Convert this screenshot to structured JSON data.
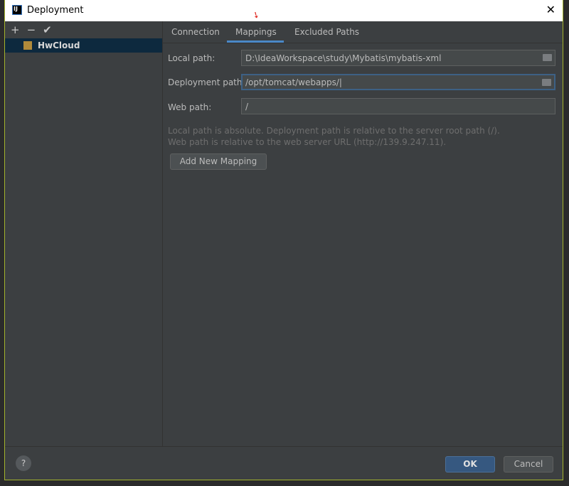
{
  "window": {
    "title": "Deployment"
  },
  "sidebar": {
    "toolbar": [
      "+",
      "−",
      "✔"
    ],
    "items": [
      {
        "label": "HwCloud",
        "selected": true,
        "icon": "sftp-server-icon"
      }
    ]
  },
  "tabs": [
    {
      "label": "Connection"
    },
    {
      "label": "Mappings",
      "active": true
    },
    {
      "label": "Excluded Paths"
    }
  ],
  "form": {
    "local_path": {
      "label": "Local path:",
      "value": "D:\\IdeaWorkspace\\study\\Mybatis\\mybatis-xml"
    },
    "deployment_path": {
      "label": "Deployment path:",
      "value": "/opt/tomcat/webapps/"
    },
    "web_path": {
      "label": "Web path:",
      "value": "/"
    },
    "hint1": "Local path is absolute. Deployment path is relative to the server root path (/).",
    "hint2": "Web path is relative to the web server URL (http://139.9.247.11).",
    "add_button": "Add New Mapping"
  },
  "footer": {
    "help": "?",
    "ok": "OK",
    "cancel": "Cancel"
  },
  "colors": {
    "accent": "#4a88c7",
    "ok": "#365880",
    "selection": "#0d293e"
  }
}
